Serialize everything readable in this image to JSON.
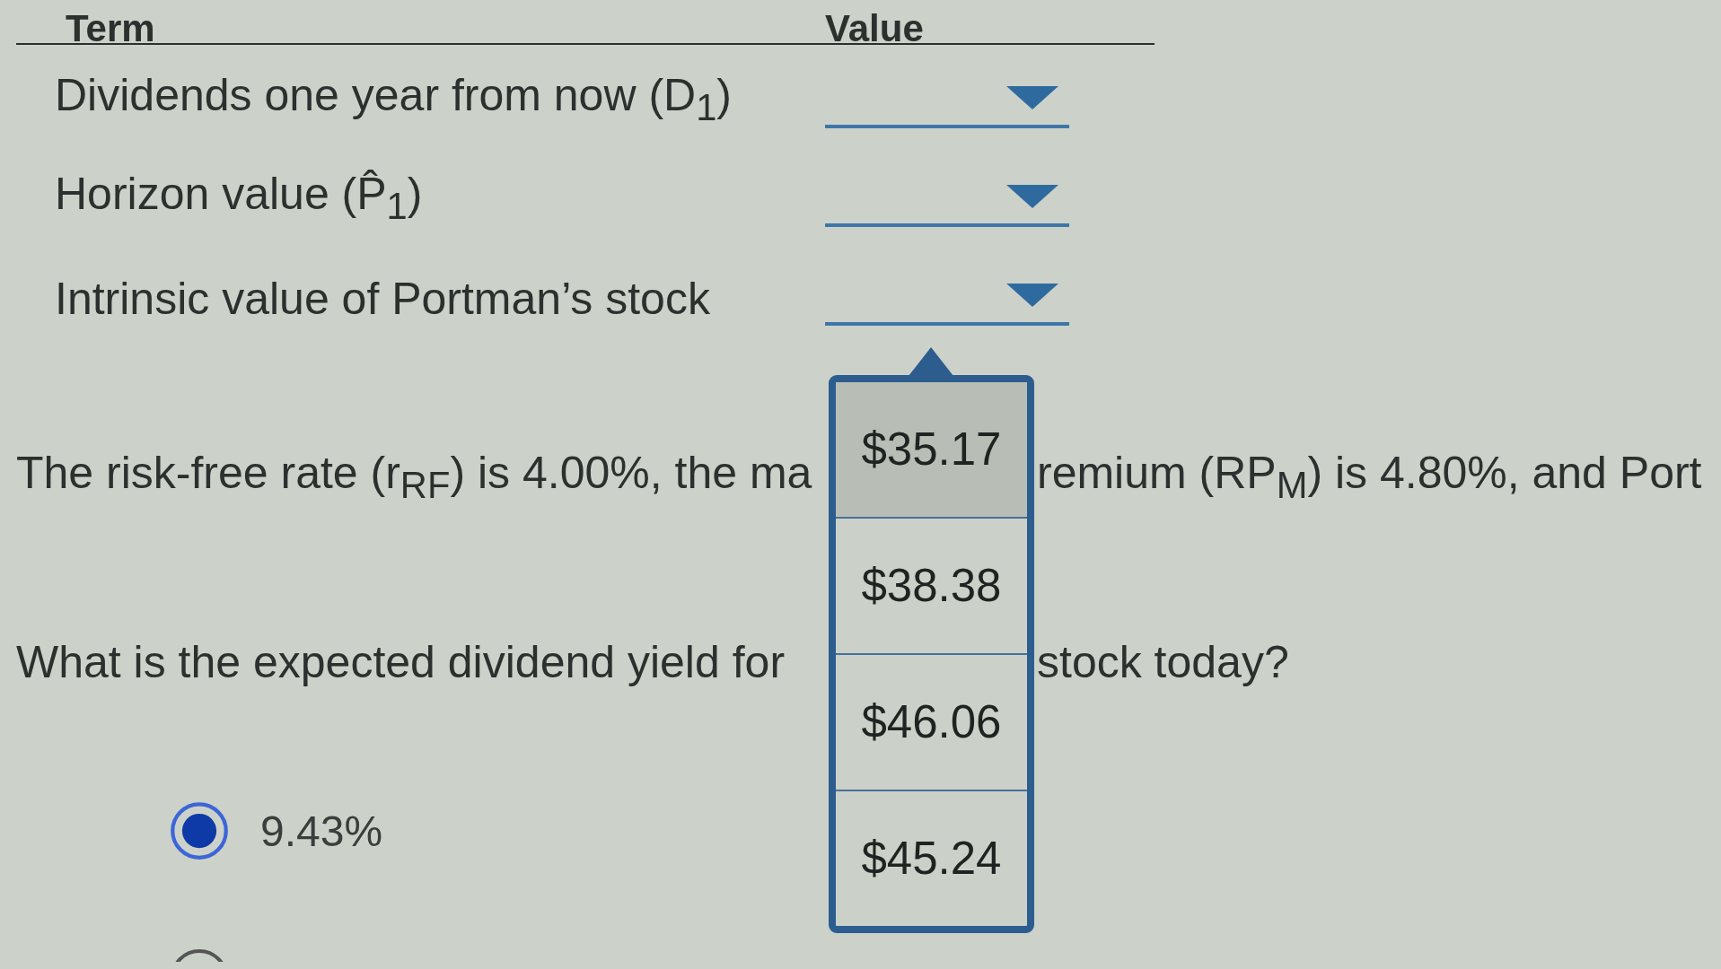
{
  "table": {
    "columns": [
      "Term",
      "Value"
    ],
    "rows": [
      {
        "term": "Dividends one year from now (D$_{1}$)",
        "dropdown": {
          "expanded": false
        }
      },
      {
        "term": "Horizon value (P̂$_{1}$)",
        "dropdown": {
          "expanded": false
        }
      },
      {
        "term": "Intrinsic value of Portman’s stock",
        "dropdown": {
          "expanded": true,
          "options": [
            {
              "label": "$35.17",
              "highlighted": true
            },
            {
              "label": "$38.38",
              "highlighted": false
            },
            {
              "label": "$46.06",
              "highlighted": false
            },
            {
              "label": "$45.24",
              "highlighted": false
            }
          ]
        }
      }
    ]
  },
  "paragraph": {
    "before": "The risk-free rate (r$_{RF}$) is 4.00%, the ma",
    "after": "remium (RP$_{M}$) is 4.80%, and Port"
  },
  "question": {
    "before": "What is the expected dividend yield for",
    "after": "stock today?"
  },
  "options": [
    {
      "label": "9.43%",
      "selected": true
    },
    {
      "selected": false
    }
  ]
}
